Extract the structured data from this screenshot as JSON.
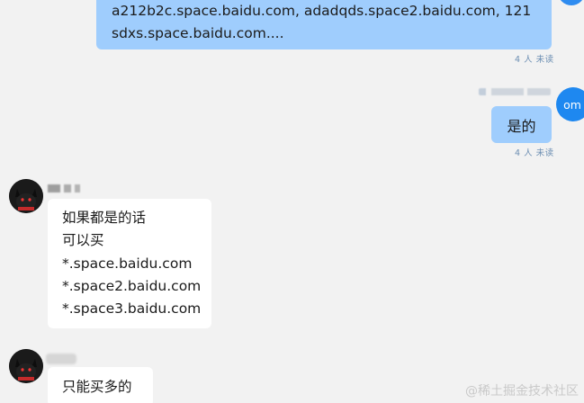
{
  "messages": {
    "outgoing_1": {
      "text": "a212b2c.space.baidu.com,   adadqds.space2.baidu.com,  121sdxs.space.baidu.com....",
      "read_status": "4 人 未读"
    },
    "outgoing_2": {
      "avatar_label": "om",
      "text": "是的",
      "read_status": "4 人 未读"
    },
    "incoming_1": {
      "lines": [
        "如果都是的话",
        "可以买",
        "*.space.baidu.com",
        "*.space2.baidu.com",
        "*.space3.baidu.com"
      ]
    },
    "incoming_2": {
      "text": "只能买多的"
    }
  },
  "watermark": "@稀土掘金技术社区",
  "colors": {
    "background": "#f2f2f2",
    "outgoing_bubble": "#9fcdfd",
    "incoming_bubble": "#ffffff",
    "avatar_blue": "#1e88f0"
  },
  "icons": {
    "user_avatar": "cat-avatar-icon",
    "self_avatar": "text-avatar"
  }
}
